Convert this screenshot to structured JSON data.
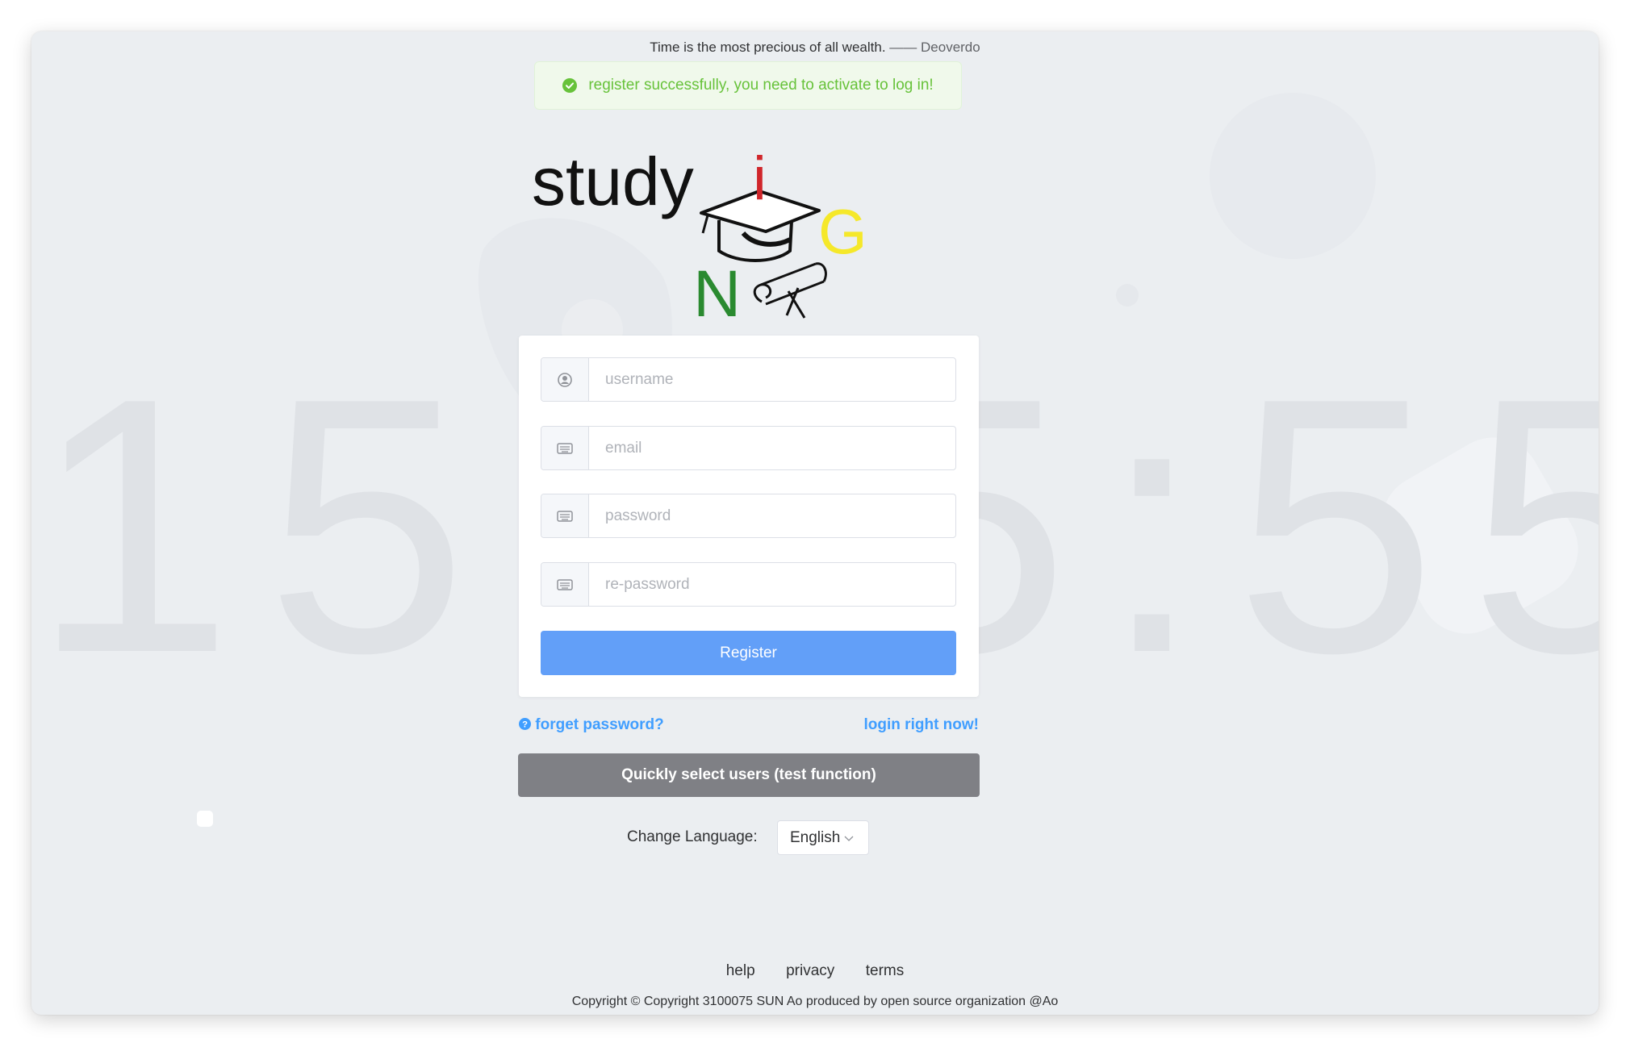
{
  "background_clock": "15:55:55",
  "quote": {
    "text": "Time is the most precious of all wealth.",
    "author": "—— Deoverdo"
  },
  "alert": {
    "message": "register successfully, you need to activate to log in!"
  },
  "logo": {
    "word": "study",
    "letter_i": "i",
    "letter_n": "N",
    "letter_g": "G"
  },
  "form": {
    "username_placeholder": "username",
    "email_placeholder": "email",
    "password_placeholder": "password",
    "repassword_placeholder": "re-password",
    "register_label": "Register"
  },
  "links": {
    "forget": "forget password?",
    "login": "login right now!"
  },
  "quick_select_label": "Quickly select users (test function)",
  "language": {
    "label": "Change Language:",
    "selected": "English"
  },
  "footer": {
    "help": "help",
    "privacy": "privacy",
    "terms": "terms",
    "copyright": "Copyright © Copyright 3100075 SUN Ao produced by open source organization @Ao"
  },
  "colors": {
    "primary": "#629ff8",
    "link": "#409eff",
    "success": "#67c23a",
    "quick_button": "#7f8085",
    "background": "#ebeef1"
  },
  "icons": [
    "user-icon",
    "keyboard-icon",
    "question-circle-icon",
    "check-circle-icon",
    "chevron-down-icon"
  ]
}
